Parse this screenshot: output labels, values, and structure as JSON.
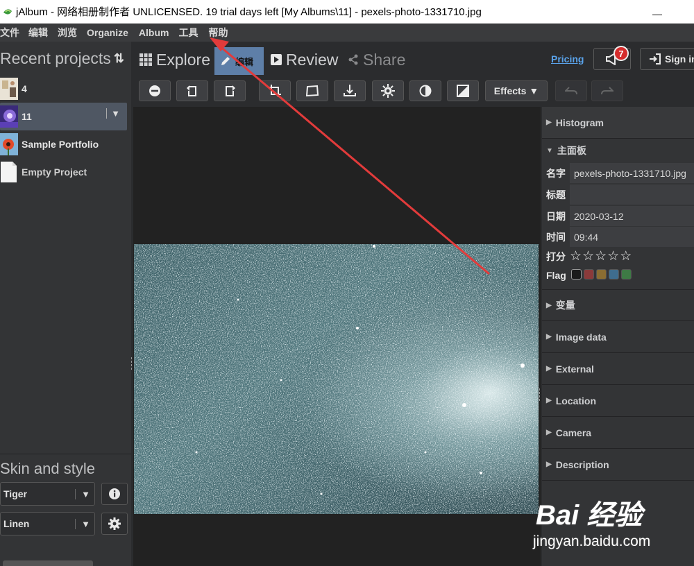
{
  "window": {
    "title": "jAlbum - 网络相册制作者 UNLICENSED. 19 trial days left [My Albums\\11] - pexels-photo-1331710.jpg",
    "minimize": "—"
  },
  "menu": [
    "文件",
    "编辑",
    "浏览",
    "Organize",
    "Album",
    "工具",
    "帮助"
  ],
  "sidebar": {
    "recent_title": "Recent projects",
    "sort_glyph": "⇅",
    "projects": [
      {
        "label": "4"
      },
      {
        "label": "11",
        "selected": true,
        "dropdown": "▼"
      },
      {
        "label": "Sample Portfolio"
      },
      {
        "label": "Empty Project"
      }
    ],
    "skin_title": "Skin and style",
    "skin_value": "Tiger",
    "style_value": "Linen",
    "arrow": "▼"
  },
  "tabs": {
    "explore": "Explore",
    "edit": "编辑",
    "review": "Review",
    "share": "Share",
    "pricing": "Pricing",
    "notifications": "7",
    "sign_in": "Sign in"
  },
  "toolbar": {
    "effects": "Effects ▼",
    "icons": [
      "minus-circle-icon",
      "rotate-left-icon",
      "rotate-right-icon",
      "crop-icon",
      "straighten-icon",
      "flip-icon",
      "brightness-icon",
      "contrast-icon",
      "levels-icon",
      "undo-icon",
      "redo-icon"
    ]
  },
  "panel": {
    "sections_top": {
      "histogram": "Histogram",
      "main_panel": "主面板"
    },
    "fields": {
      "name_label": "名字",
      "name_value": "pexels-photo-1331710.jpg",
      "title_label": "标题",
      "title_value": "",
      "date_label": "日期",
      "date_value": "2020-03-12",
      "time_label": "时间",
      "time_value": "09:44",
      "rating_label": "打分",
      "rating_value": 0,
      "rating_max": 5,
      "flag_label": "Flag",
      "flag_colors": [
        "#1b1b1b",
        "#8b3a3a",
        "#8a6d32",
        "#3f6d8e",
        "#3e7a45"
      ]
    },
    "sections": [
      "变量",
      "Image data",
      "External",
      "Location",
      "Camera",
      "Description"
    ]
  },
  "watermark": {
    "brand": "Bai 经验",
    "site": "jingyan.baidu.com"
  },
  "colors": {
    "accent": "#5e7fa8",
    "pricing": "#5aa3ea",
    "annotation": "#e23b3b"
  }
}
